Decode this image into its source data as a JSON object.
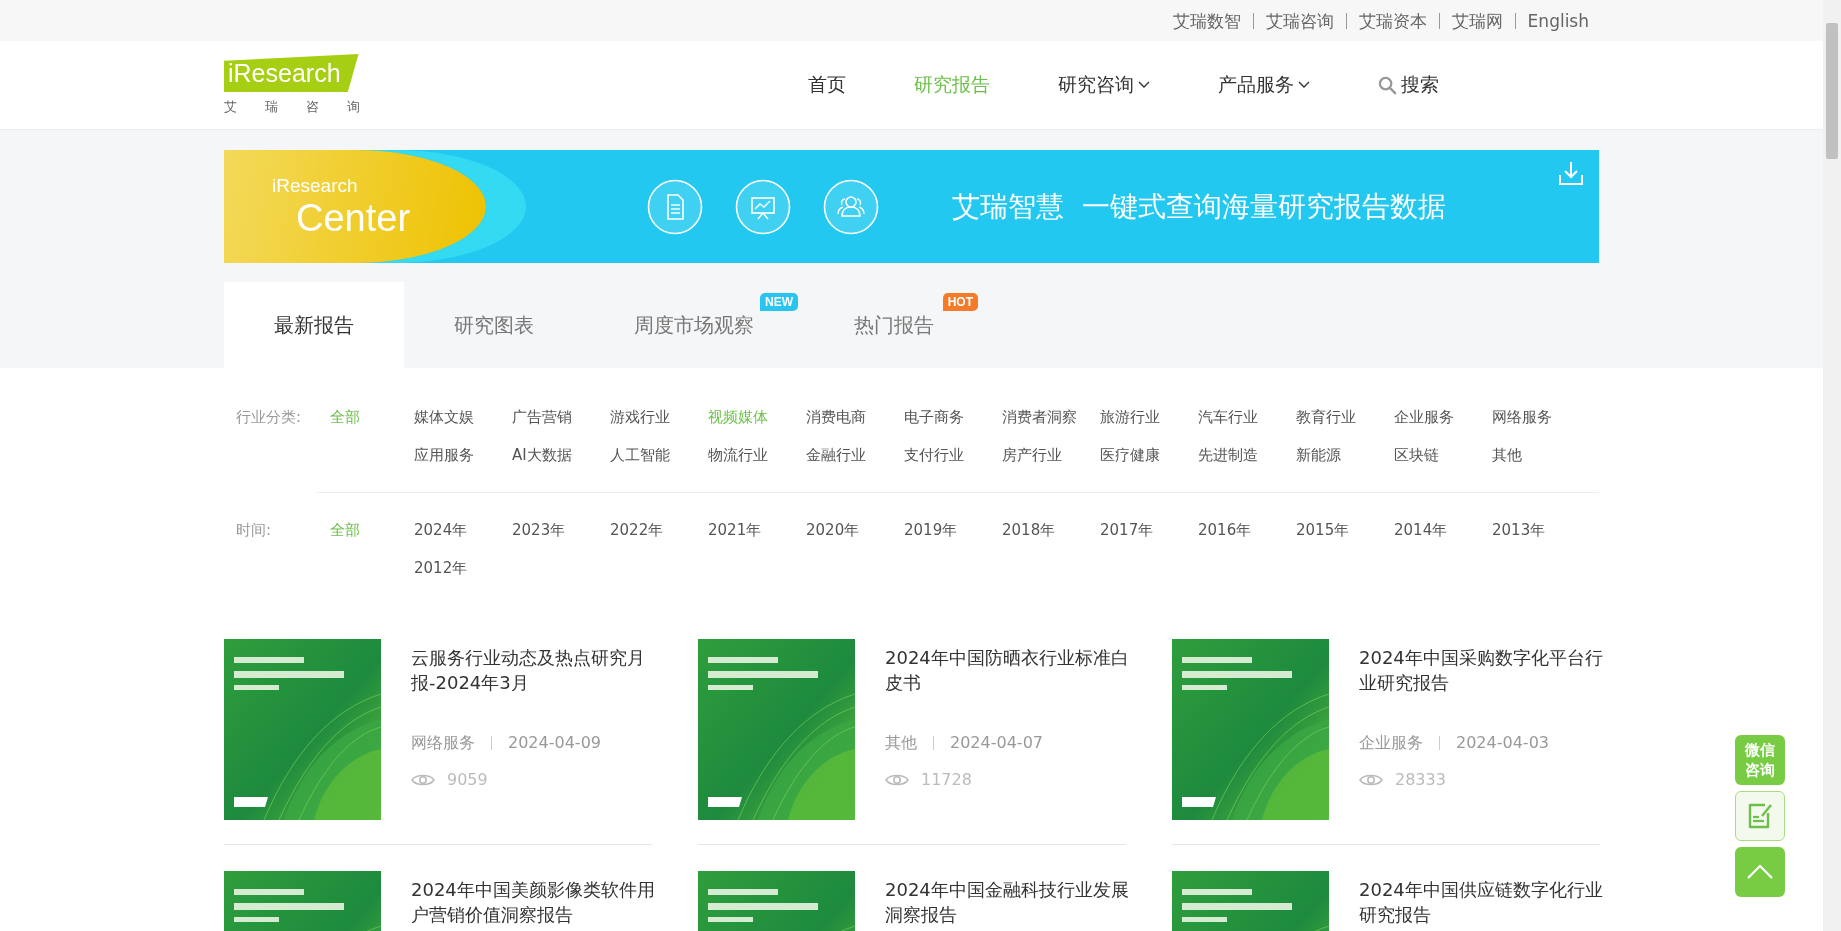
{
  "top_links": [
    {
      "label": "艾瑞数智"
    },
    {
      "label": "艾瑞咨询"
    },
    {
      "label": "艾瑞资本"
    },
    {
      "label": "艾瑞网"
    },
    {
      "label": "English"
    }
  ],
  "logo": {
    "brand": "iResearch",
    "subtitle": "艾 瑞 咨 询"
  },
  "nav": [
    {
      "label": "首页",
      "selected": false,
      "kind": "link"
    },
    {
      "label": "研究报告",
      "selected": true,
      "kind": "link"
    },
    {
      "label": "研究咨询",
      "selected": false,
      "kind": "dropdown"
    },
    {
      "label": "产品服务",
      "selected": false,
      "kind": "dropdown"
    },
    {
      "label": "搜索",
      "selected": false,
      "kind": "search"
    }
  ],
  "banner": {
    "brand_small": "iResearch",
    "brand_large": "Center",
    "slogan_parts": [
      "艾瑞智慧",
      "一键式查询海量研究报告数据"
    ]
  },
  "tabs": [
    {
      "label": "最新报告",
      "selected": true
    },
    {
      "label": "研究图表",
      "selected": false
    },
    {
      "label": "周度市场观察",
      "selected": false,
      "badge": {
        "text": "NEW",
        "color": "#29c4f0"
      }
    },
    {
      "label": "热门报告",
      "selected": false,
      "badge": {
        "text": "HOT",
        "color": "#f47b2a"
      }
    }
  ],
  "filters": [
    {
      "label": "行业分类:",
      "all": {
        "label": "全部",
        "selected": true
      },
      "options": [
        {
          "label": "媒体文娱",
          "selected": false
        },
        {
          "label": "广告营销",
          "selected": false
        },
        {
          "label": "游戏行业",
          "selected": false
        },
        {
          "label": "视频媒体",
          "selected": true
        },
        {
          "label": "消费电商",
          "selected": false
        },
        {
          "label": "电子商务",
          "selected": false
        },
        {
          "label": "消费者洞察",
          "selected": false
        },
        {
          "label": "旅游行业",
          "selected": false
        },
        {
          "label": "汽车行业",
          "selected": false
        },
        {
          "label": "教育行业",
          "selected": false
        },
        {
          "label": "企业服务",
          "selected": false
        },
        {
          "label": "网络服务",
          "selected": false
        },
        {
          "label": "应用服务",
          "selected": false
        },
        {
          "label": "AI大数据",
          "selected": false
        },
        {
          "label": "人工智能",
          "selected": false
        },
        {
          "label": "物流行业",
          "selected": false
        },
        {
          "label": "金融行业",
          "selected": false
        },
        {
          "label": "支付行业",
          "selected": false
        },
        {
          "label": "房产行业",
          "selected": false
        },
        {
          "label": "医疗健康",
          "selected": false
        },
        {
          "label": "先进制造",
          "selected": false
        },
        {
          "label": "新能源",
          "selected": false
        },
        {
          "label": "区块链",
          "selected": false
        },
        {
          "label": "其他",
          "selected": false
        }
      ]
    },
    {
      "label": "时间:",
      "all": {
        "label": "全部",
        "selected": true
      },
      "options": [
        {
          "label": "2024年",
          "selected": false
        },
        {
          "label": "2023年",
          "selected": false
        },
        {
          "label": "2022年",
          "selected": false
        },
        {
          "label": "2021年",
          "selected": false
        },
        {
          "label": "2020年",
          "selected": false
        },
        {
          "label": "2019年",
          "selected": false
        },
        {
          "label": "2018年",
          "selected": false
        },
        {
          "label": "2017年",
          "selected": false
        },
        {
          "label": "2016年",
          "selected": false
        },
        {
          "label": "2015年",
          "selected": false
        },
        {
          "label": "2014年",
          "selected": false
        },
        {
          "label": "2013年",
          "selected": false
        },
        {
          "label": "2012年",
          "selected": false
        }
      ]
    }
  ],
  "reports": [
    {
      "title": "云服务行业动态及热点研究月报-2024年3月",
      "category": "网络服务",
      "date": "2024-04-09",
      "views": "9059"
    },
    {
      "title": "2024年中国防晒衣行业标准白皮书",
      "category": "其他",
      "date": "2024-04-07",
      "views": "11728"
    },
    {
      "title": "2024年中国采购数字化平台行业研究报告",
      "category": "企业服务",
      "date": "2024-04-03",
      "views": "28333"
    },
    {
      "title": "2024年中国美颜影像类软件用户营销价值洞察报告"
    },
    {
      "title": "2024年中国金融科技行业发展洞察报告"
    },
    {
      "title": "2024年中国供应链数字化行业研究报告"
    }
  ],
  "side_buttons": [
    {
      "kind": "text",
      "label": "微信咨询"
    },
    {
      "kind": "edit"
    },
    {
      "kind": "top"
    }
  ]
}
